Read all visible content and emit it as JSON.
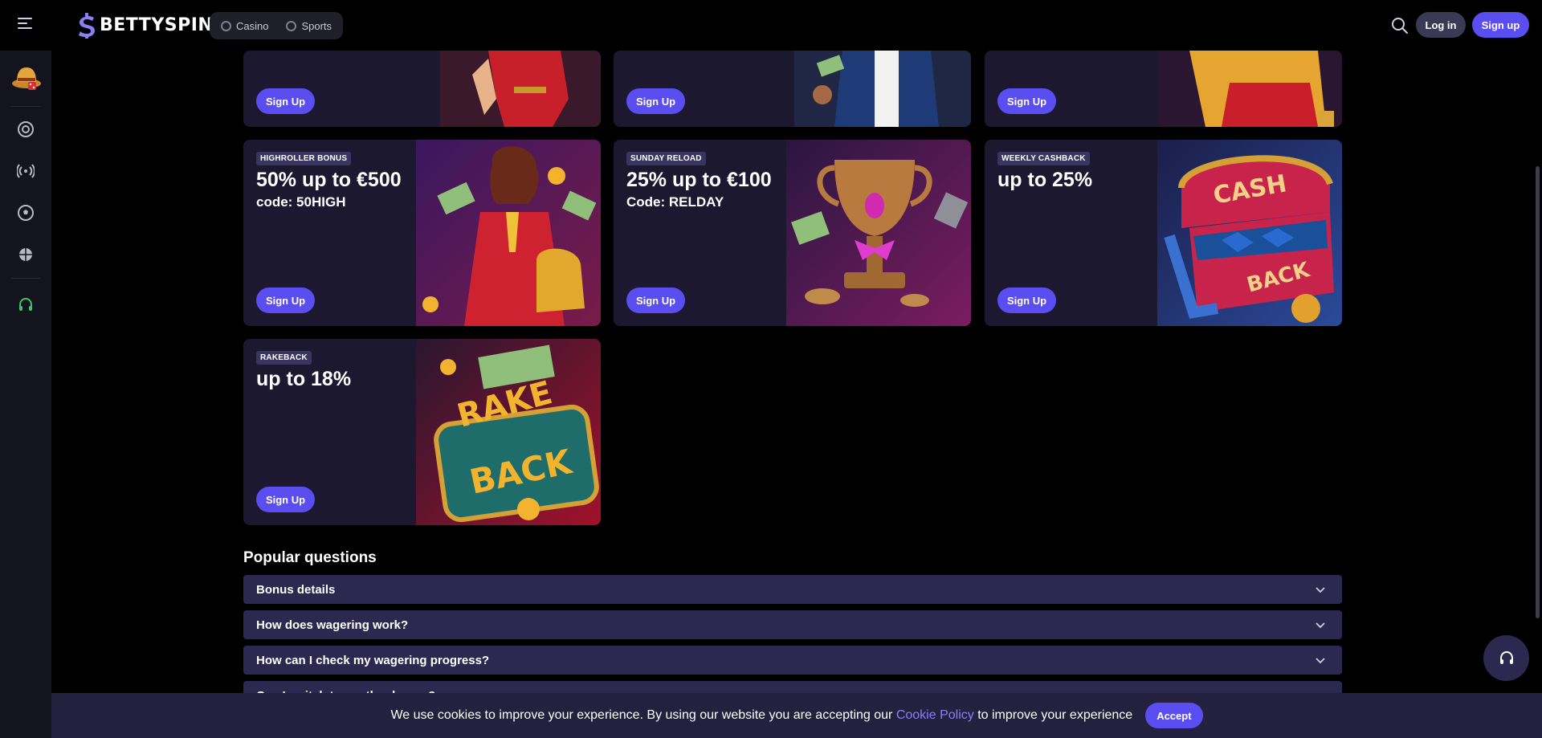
{
  "header": {
    "logo_text": "BETTYSPIN",
    "nav": [
      {
        "label": "Casino",
        "icon": "casino-icon"
      },
      {
        "label": "Sports",
        "icon": "sports-icon"
      }
    ],
    "login_label": "Log in",
    "signup_label": "Sign up"
  },
  "sidebar": {
    "items": [
      {
        "icon": "hat-avatar-icon"
      },
      {
        "icon": "casino-chip-icon"
      },
      {
        "icon": "live-broadcast-icon"
      },
      {
        "icon": "soccer-ball-icon"
      },
      {
        "icon": "basketball-icon"
      },
      {
        "icon": "support-headset-icon"
      }
    ]
  },
  "promos": [
    {
      "badge": "",
      "headline": "",
      "code": "",
      "button": "Sign Up",
      "art": "woman-in-red-art"
    },
    {
      "badge": "",
      "headline": "",
      "code": "",
      "button": "Sign Up",
      "art": "man-with-money-art"
    },
    {
      "badge": "",
      "headline": "",
      "code": "",
      "button": "Sign Up",
      "art": "woman-in-gold-art"
    },
    {
      "badge": "HIGHROLLER BONUS",
      "headline": "50% up to €500",
      "code": "code: 50HIGH",
      "button": "Sign Up",
      "art": "highroller-woman-art"
    },
    {
      "badge": "SUNDAY RELOAD",
      "headline": "25% up to €100",
      "code": "Code: RELDAY",
      "button": "Sign Up",
      "art": "trophy-art"
    },
    {
      "badge": "WEEKLY CASHBACK",
      "headline": "up to 25%",
      "code": "",
      "button": "Sign Up",
      "art": "cashback-chest-art"
    },
    {
      "badge": "RAKEBACK",
      "headline": "up to 18%",
      "code": "",
      "button": "Sign Up",
      "art": "rakeback-sign-art"
    }
  ],
  "faq": {
    "title": "Popular questions",
    "items": [
      "Bonus details",
      "How does wagering work?",
      "How can I check my wagering progress?",
      "Can I switch to another bonus?"
    ]
  },
  "cookie": {
    "text_before": "We use cookies to improve your experience. By using our website you are accepting our",
    "link": "Cookie Policy",
    "text_after": "to improve your experience",
    "accept": "Accept"
  },
  "colors": {
    "accent": "#5b4ef0",
    "card_bg": "#1b1830",
    "faq_bg": "#2c2850"
  }
}
